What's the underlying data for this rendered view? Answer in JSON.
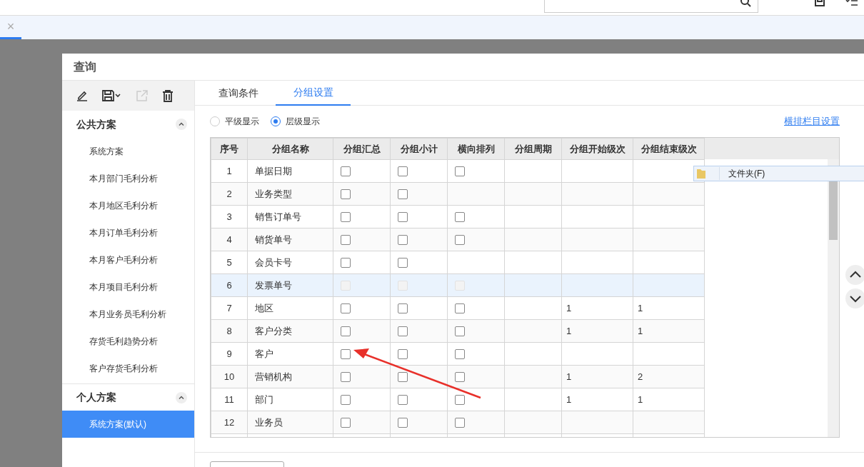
{
  "doc_tabs": [
    {
      "close": "×",
      "selected": true
    }
  ],
  "dialog": {
    "title": "查询",
    "sidebar": {
      "groups": [
        {
          "title": "公共方案",
          "expanded": true,
          "items": [
            {
              "label": "系统方案",
              "selected": false
            },
            {
              "label": "本月部门毛利分析",
              "selected": false
            },
            {
              "label": "本月地区毛利分析",
              "selected": false
            },
            {
              "label": "本月订单毛利分析",
              "selected": false
            },
            {
              "label": "本月客户毛利分析",
              "selected": false
            },
            {
              "label": "本月项目毛利分析",
              "selected": false
            },
            {
              "label": "本月业务员毛利分析",
              "selected": false
            },
            {
              "label": "存货毛利趋势分析",
              "selected": false
            },
            {
              "label": "客户存货毛利分析",
              "selected": false
            }
          ]
        },
        {
          "title": "个人方案",
          "expanded": true,
          "items": [
            {
              "label": "系统方案(默认)",
              "selected": true
            }
          ]
        }
      ]
    },
    "tabs": [
      {
        "label": "查询条件",
        "selected": false
      },
      {
        "label": "分组设置",
        "selected": true
      }
    ],
    "display_mode": [
      {
        "label": "平级显示",
        "selected": false
      },
      {
        "label": "层级显示",
        "selected": true
      }
    ],
    "column_settings_link": "横排栏目设置",
    "table": {
      "columns": [
        "序号",
        "分组名称",
        "分组汇总",
        "分组小计",
        "横向排列",
        "分组周期",
        "分组开始级次",
        "分组结束级次"
      ],
      "rows": [
        {
          "no": "1",
          "name": "单据日期",
          "summary": {
            "checked": false
          },
          "subtotal": {
            "checked": false
          },
          "horizontal": {
            "checked": false
          },
          "selected": false,
          "disabled": false
        },
        {
          "no": "2",
          "name": "业务类型",
          "summary": {
            "checked": false
          },
          "subtotal": {
            "checked": false
          },
          "selected": false,
          "disabled": false
        },
        {
          "no": "3",
          "name": "销售订单号",
          "summary": {
            "checked": false
          },
          "subtotal": {
            "checked": false
          },
          "horizontal": {
            "checked": false
          },
          "selected": false,
          "disabled": false
        },
        {
          "no": "4",
          "name": "销货单号",
          "summary": {
            "checked": false
          },
          "subtotal": {
            "checked": false
          },
          "horizontal": {
            "checked": false
          },
          "selected": false,
          "disabled": false
        },
        {
          "no": "5",
          "name": "会员卡号",
          "summary": {
            "checked": false
          },
          "subtotal": {
            "checked": false
          },
          "selected": false,
          "disabled": false
        },
        {
          "no": "6",
          "name": "发票单号",
          "summary": {
            "checked": false
          },
          "subtotal": {
            "checked": false
          },
          "horizontal": {
            "checked": false
          },
          "selected": true,
          "disabled": true
        },
        {
          "no": "7",
          "name": "地区",
          "summary": {
            "checked": false
          },
          "subtotal": {
            "checked": false
          },
          "horizontal": {
            "checked": false
          },
          "start_level": "1",
          "end_level": "1",
          "selected": false,
          "disabled": false
        },
        {
          "no": "8",
          "name": "客户分类",
          "summary": {
            "checked": false
          },
          "subtotal": {
            "checked": false
          },
          "horizontal": {
            "checked": false
          },
          "start_level": "1",
          "end_level": "1",
          "selected": false,
          "disabled": false
        },
        {
          "no": "9",
          "name": "客户",
          "summary": {
            "checked": false
          },
          "subtotal": {
            "checked": false
          },
          "horizontal": {
            "checked": false
          },
          "selected": false,
          "disabled": false
        },
        {
          "no": "10",
          "name": "营销机构",
          "summary": {
            "checked": false
          },
          "subtotal": {
            "checked": false
          },
          "horizontal": {
            "checked": false
          },
          "start_level": "1",
          "end_level": "2",
          "selected": false,
          "disabled": false
        },
        {
          "no": "11",
          "name": "部门",
          "summary": {
            "checked": false
          },
          "subtotal": {
            "checked": false
          },
          "horizontal": {
            "checked": false
          },
          "start_level": "1",
          "end_level": "1",
          "selected": false,
          "disabled": false
        },
        {
          "no": "12",
          "name": "业务员",
          "summary": {
            "checked": false
          },
          "subtotal": {
            "checked": false
          },
          "horizontal": {
            "checked": false
          },
          "selected": false,
          "disabled": false
        }
      ]
    },
    "bottom_button": {
      "kind": "button"
    }
  },
  "context_menu": {
    "items": [
      {
        "label": "文件夹(F)"
      }
    ]
  }
}
